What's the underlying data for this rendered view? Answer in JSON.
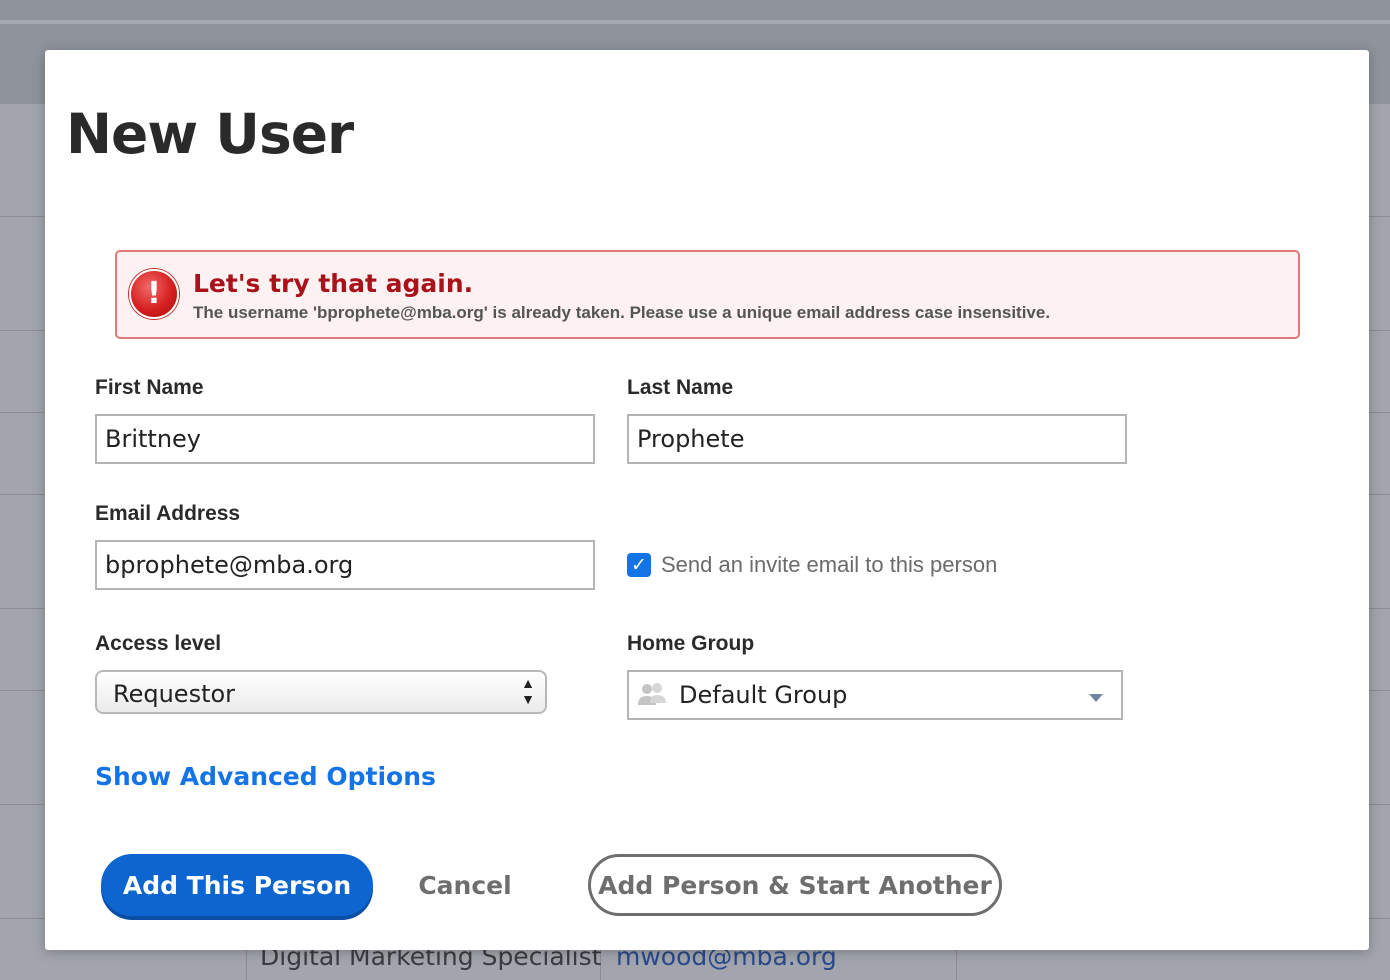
{
  "background": {
    "rows": [
      {
        "title": "Digital Marketing Specialist",
        "email": "mwood@mba.org"
      }
    ]
  },
  "dialog": {
    "title": "New User",
    "alert": {
      "title": "Let's try that again.",
      "message": "The username 'bprophete@mba.org' is already taken. Please use a unique email address case insensitive.",
      "icon": "error-icon",
      "color": "#a8121a"
    },
    "first_name": {
      "label": "First Name",
      "value": "Brittney"
    },
    "last_name": {
      "label": "Last Name",
      "value": "Prophete"
    },
    "email": {
      "label": "Email Address",
      "value": "bprophete@mba.org"
    },
    "invite": {
      "label": "Send an invite email to this person",
      "checked": true
    },
    "access_level": {
      "label": "Access level",
      "value": "Requestor"
    },
    "home_group": {
      "label": "Home Group",
      "value": "Default Group",
      "icon": "group-icon"
    },
    "advanced_link": "Show Advanced Options",
    "buttons": {
      "add": "Add This Person",
      "cancel": "Cancel",
      "add_another": "Add Person & Start Another"
    },
    "accent_color": "#1473e6"
  }
}
